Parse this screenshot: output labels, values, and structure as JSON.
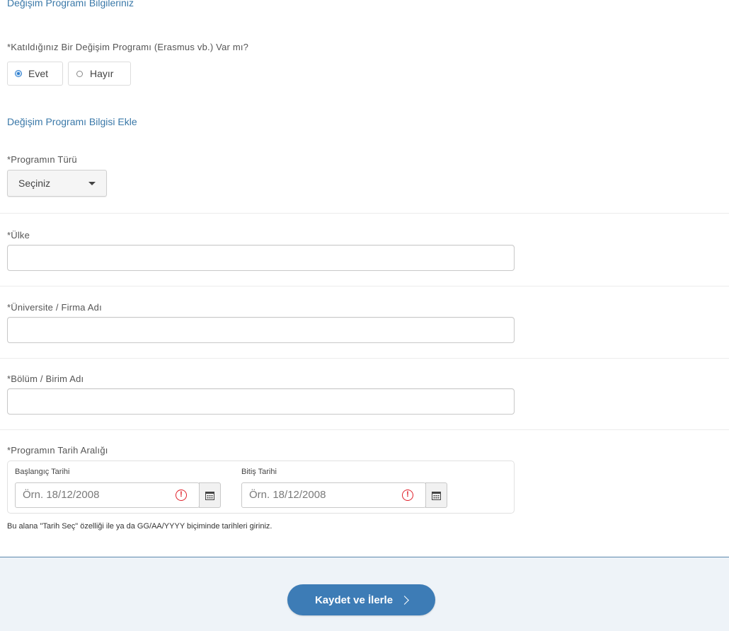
{
  "section": {
    "title": "Değişim Programı Bilgileriniz",
    "question": "*Katıldığınız Bir Değişim Programı (Erasmus vb.) Var mı?",
    "options": [
      {
        "label": "Evet",
        "selected": true
      },
      {
        "label": "Hayır",
        "selected": false
      }
    ]
  },
  "add_section": {
    "title": "Değişim Programı Bilgisi Ekle"
  },
  "program_type": {
    "label": "*Programın Türü",
    "selected_value": "Seçiniz"
  },
  "country": {
    "label": "*Ülke",
    "value": ""
  },
  "university": {
    "label": "*Üniversite / Firma Adı",
    "value": ""
  },
  "department": {
    "label": "*Bölüm / Birim Adı",
    "value": ""
  },
  "date_range": {
    "label": "*Programın Tarih Aralığı",
    "start": {
      "label": "Başlangıç Tarihi",
      "placeholder": "Örn. 18/12/2008"
    },
    "end": {
      "label": "Bitiş Tarihi",
      "placeholder": "Örn. 18/12/2008"
    },
    "hint": "Bu alana \"Tarih Seç\" özelliği ile ya da GG/AA/YYYY biçiminde tarihleri giriniz."
  },
  "footer": {
    "save_label": "Kaydet ve İlerle"
  },
  "colors": {
    "accent": "#3d7cb6",
    "section_title": "#3a78a8",
    "warning": "#e0202a",
    "footer_bg": "#eef3f8"
  }
}
